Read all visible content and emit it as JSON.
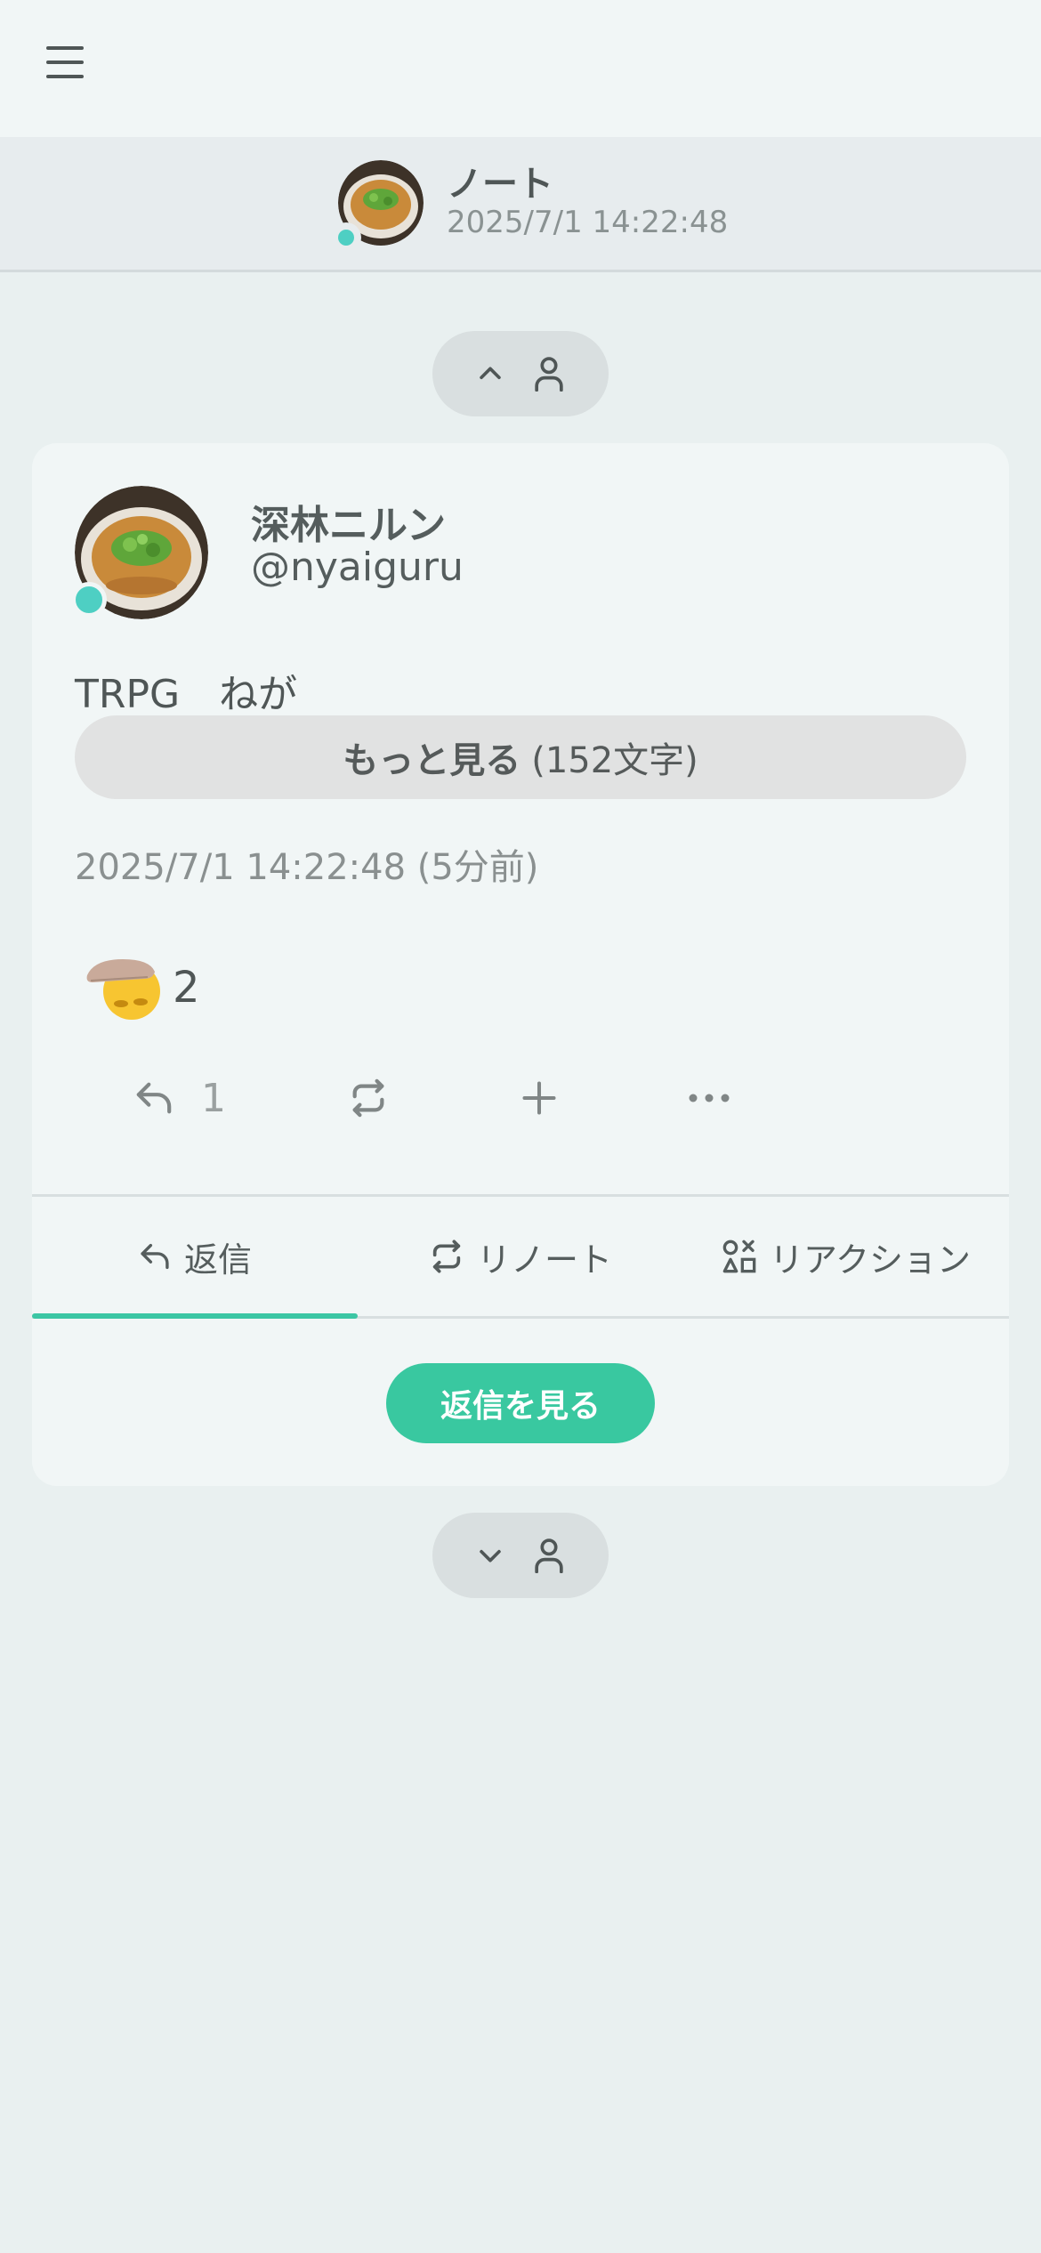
{
  "header": {
    "menu_icon": "hamburger-icon"
  },
  "page": {
    "title": "ノート",
    "timestamp": "2025/7/1 14:22:48"
  },
  "nav_prev": {
    "icons": [
      "chevron-up-icon",
      "user-icon"
    ]
  },
  "nav_next": {
    "icons": [
      "chevron-down-icon",
      "user-icon"
    ]
  },
  "note": {
    "user_name": "深林ニルン",
    "user_handle": "@nyaiguru",
    "text": "TRPG　ねが",
    "show_more_label": "もっと見る",
    "show_more_count": "(152文字)",
    "timestamp": "2025/7/1 14:22:48 (5分前)",
    "reaction": {
      "emoji": "hand-on-face-emoji",
      "count": "2"
    },
    "actions": {
      "reply_count": "1",
      "reply_icon": "reply-icon",
      "renote_icon": "renote-icon",
      "add_reaction_icon": "plus-icon",
      "more_icon": "ellipsis-icon"
    }
  },
  "tabs": [
    {
      "label": "返信",
      "icon": "reply-icon",
      "active": true
    },
    {
      "label": "リノート",
      "icon": "renote-icon",
      "active": false
    },
    {
      "label": "リアクション",
      "icon": "shapes-icon",
      "active": false
    }
  ],
  "view_replies_label": "返信を見る",
  "colors": {
    "accent": "#39c8a0",
    "online": "#4ecfc3",
    "background": "#e9f0f0"
  }
}
